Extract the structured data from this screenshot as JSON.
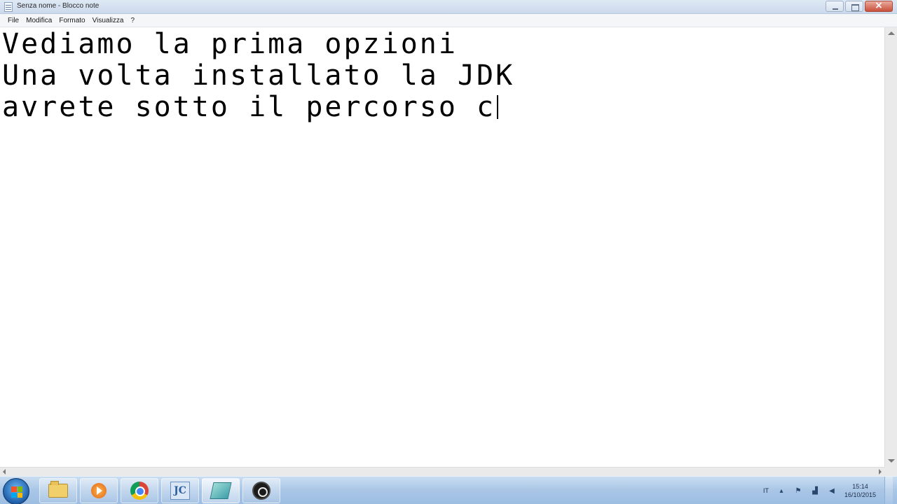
{
  "window": {
    "title": "Senza nome - Blocco note",
    "controls": {
      "minimize": "minimize",
      "maximize": "maximize",
      "close": "close"
    }
  },
  "menu": [
    {
      "label": "File"
    },
    {
      "label": "Modifica"
    },
    {
      "label": "Formato"
    },
    {
      "label": "Visualizza"
    },
    {
      "label": "?"
    }
  ],
  "editor": {
    "lines": [
      "Vediamo la prima opzioni",
      "Una volta installato la JDK",
      "avrete sotto il percorso c"
    ]
  },
  "taskbar": {
    "apps": [
      {
        "icon": "folder-icon"
      },
      {
        "icon": "media-player-icon"
      },
      {
        "icon": "chrome-icon"
      },
      {
        "icon": "jcreator-icon",
        "text": "JC"
      },
      {
        "icon": "notepad-icon"
      },
      {
        "icon": "obs-icon"
      }
    ],
    "tray": {
      "language": "IT",
      "time": "15:14",
      "date": "16/10/2015"
    }
  }
}
